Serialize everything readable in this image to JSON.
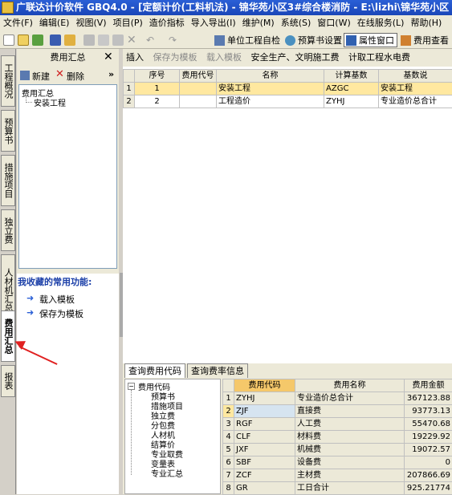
{
  "window": {
    "title": "广联达计价软件 GBQ4.0 - [定额计价(工料机法) - 锦华苑小区3#综合楼消防 - E:\\lizhi\\锦华苑小区"
  },
  "menu": [
    "文件(F)",
    "编辑(E)",
    "视图(V)",
    "项目(P)",
    "造价指标",
    "导入导出(I)",
    "维护(M)",
    "系统(S)",
    "窗口(W)",
    "在线服务(L)",
    "帮助(H)"
  ],
  "toolbar": {
    "unit_check": "单位工程自检",
    "budget_settings": "预算书设置",
    "property_window": "属性窗口",
    "fee_view": "费用查看"
  },
  "left_tabs": [
    "工程概况",
    "预算书",
    "措施项目",
    "独立费",
    "人材机汇总",
    "费用汇总",
    "报表"
  ],
  "panel": {
    "title": "费用汇总",
    "new": "新建",
    "delete": "删除",
    "tree_root": "费用汇总",
    "tree_child": "安装工程",
    "fav_title": "我收藏的常用功能:",
    "fav_items": [
      "载入模板",
      "保存为模板"
    ]
  },
  "subbar": [
    "插入",
    "保存为模板",
    "载入模板",
    "安全生产、文明施工费",
    "计取工程水电费"
  ],
  "grid1": {
    "headers": [
      "序号",
      "费用代号",
      "名称",
      "计算基数",
      "基数说"
    ],
    "rows": [
      {
        "idx": "1",
        "seq": "1",
        "code": "",
        "name": "安装工程",
        "base": "AZGC",
        "desc": "安装工程"
      },
      {
        "idx": "2",
        "seq": "2",
        "code": "",
        "name": "工程造价",
        "base": "ZYHJ",
        "desc": "专业造价总合计"
      }
    ]
  },
  "lower": {
    "tabs": [
      "查询费用代码",
      "查询费率信息"
    ],
    "tree_root": "费用代码",
    "tree_items": [
      "预算书",
      "措施项目",
      "独立费",
      "分包费",
      "人材机",
      "结算价",
      "专业取费",
      "变量表",
      "专业汇总"
    ],
    "headers": [
      "费用代码",
      "费用名称",
      "费用金额"
    ],
    "rows": [
      {
        "n": "1",
        "code": "ZYHJ",
        "name": "专业造价总合计",
        "amount": "367123.88"
      },
      {
        "n": "2",
        "code": "ZJF",
        "name": "直接费",
        "amount": "93773.13"
      },
      {
        "n": "3",
        "code": "RGF",
        "name": "人工费",
        "amount": "55470.68"
      },
      {
        "n": "4",
        "code": "CLF",
        "name": "材料费",
        "amount": "19229.92"
      },
      {
        "n": "5",
        "code": "JXF",
        "name": "机械费",
        "amount": "19072.57"
      },
      {
        "n": "6",
        "code": "SBF",
        "name": "设备费",
        "amount": "0"
      },
      {
        "n": "7",
        "code": "ZCF",
        "name": "主材费",
        "amount": "207866.69"
      },
      {
        "n": "8",
        "code": "GR",
        "name": "工日合计",
        "amount": "925.21774"
      }
    ]
  },
  "colors": {
    "highlight": "#ffe8a0",
    "selected_cell": "#d6e4f0",
    "fav_title": "#1b3fa8",
    "arrow": "#e02020"
  }
}
